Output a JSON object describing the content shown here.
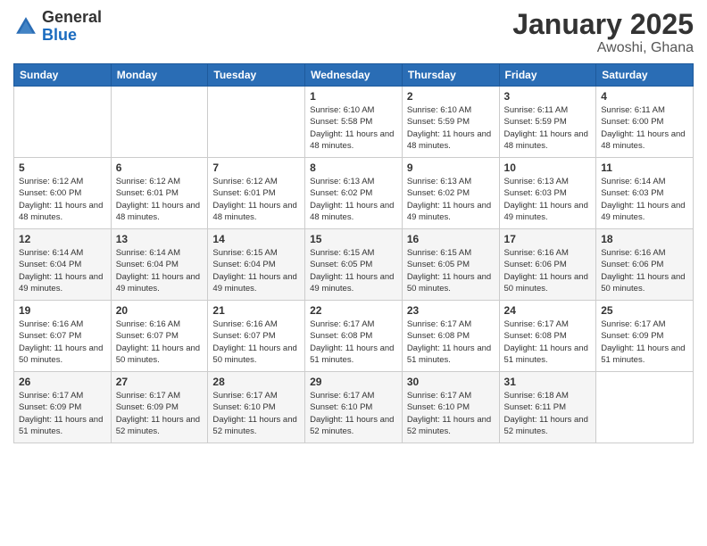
{
  "logo": {
    "general": "General",
    "blue": "Blue"
  },
  "header": {
    "title": "January 2025",
    "subtitle": "Awoshi, Ghana"
  },
  "weekdays": [
    "Sunday",
    "Monday",
    "Tuesday",
    "Wednesday",
    "Thursday",
    "Friday",
    "Saturday"
  ],
  "weeks": [
    [
      {
        "day": "",
        "sunrise": "",
        "sunset": "",
        "daylight": ""
      },
      {
        "day": "",
        "sunrise": "",
        "sunset": "",
        "daylight": ""
      },
      {
        "day": "",
        "sunrise": "",
        "sunset": "",
        "daylight": ""
      },
      {
        "day": "1",
        "sunrise": "Sunrise: 6:10 AM",
        "sunset": "Sunset: 5:58 PM",
        "daylight": "Daylight: 11 hours and 48 minutes."
      },
      {
        "day": "2",
        "sunrise": "Sunrise: 6:10 AM",
        "sunset": "Sunset: 5:59 PM",
        "daylight": "Daylight: 11 hours and 48 minutes."
      },
      {
        "day": "3",
        "sunrise": "Sunrise: 6:11 AM",
        "sunset": "Sunset: 5:59 PM",
        "daylight": "Daylight: 11 hours and 48 minutes."
      },
      {
        "day": "4",
        "sunrise": "Sunrise: 6:11 AM",
        "sunset": "Sunset: 6:00 PM",
        "daylight": "Daylight: 11 hours and 48 minutes."
      }
    ],
    [
      {
        "day": "5",
        "sunrise": "Sunrise: 6:12 AM",
        "sunset": "Sunset: 6:00 PM",
        "daylight": "Daylight: 11 hours and 48 minutes."
      },
      {
        "day": "6",
        "sunrise": "Sunrise: 6:12 AM",
        "sunset": "Sunset: 6:01 PM",
        "daylight": "Daylight: 11 hours and 48 minutes."
      },
      {
        "day": "7",
        "sunrise": "Sunrise: 6:12 AM",
        "sunset": "Sunset: 6:01 PM",
        "daylight": "Daylight: 11 hours and 48 minutes."
      },
      {
        "day": "8",
        "sunrise": "Sunrise: 6:13 AM",
        "sunset": "Sunset: 6:02 PM",
        "daylight": "Daylight: 11 hours and 48 minutes."
      },
      {
        "day": "9",
        "sunrise": "Sunrise: 6:13 AM",
        "sunset": "Sunset: 6:02 PM",
        "daylight": "Daylight: 11 hours and 49 minutes."
      },
      {
        "day": "10",
        "sunrise": "Sunrise: 6:13 AM",
        "sunset": "Sunset: 6:03 PM",
        "daylight": "Daylight: 11 hours and 49 minutes."
      },
      {
        "day": "11",
        "sunrise": "Sunrise: 6:14 AM",
        "sunset": "Sunset: 6:03 PM",
        "daylight": "Daylight: 11 hours and 49 minutes."
      }
    ],
    [
      {
        "day": "12",
        "sunrise": "Sunrise: 6:14 AM",
        "sunset": "Sunset: 6:04 PM",
        "daylight": "Daylight: 11 hours and 49 minutes."
      },
      {
        "day": "13",
        "sunrise": "Sunrise: 6:14 AM",
        "sunset": "Sunset: 6:04 PM",
        "daylight": "Daylight: 11 hours and 49 minutes."
      },
      {
        "day": "14",
        "sunrise": "Sunrise: 6:15 AM",
        "sunset": "Sunset: 6:04 PM",
        "daylight": "Daylight: 11 hours and 49 minutes."
      },
      {
        "day": "15",
        "sunrise": "Sunrise: 6:15 AM",
        "sunset": "Sunset: 6:05 PM",
        "daylight": "Daylight: 11 hours and 49 minutes."
      },
      {
        "day": "16",
        "sunrise": "Sunrise: 6:15 AM",
        "sunset": "Sunset: 6:05 PM",
        "daylight": "Daylight: 11 hours and 50 minutes."
      },
      {
        "day": "17",
        "sunrise": "Sunrise: 6:16 AM",
        "sunset": "Sunset: 6:06 PM",
        "daylight": "Daylight: 11 hours and 50 minutes."
      },
      {
        "day": "18",
        "sunrise": "Sunrise: 6:16 AM",
        "sunset": "Sunset: 6:06 PM",
        "daylight": "Daylight: 11 hours and 50 minutes."
      }
    ],
    [
      {
        "day": "19",
        "sunrise": "Sunrise: 6:16 AM",
        "sunset": "Sunset: 6:07 PM",
        "daylight": "Daylight: 11 hours and 50 minutes."
      },
      {
        "day": "20",
        "sunrise": "Sunrise: 6:16 AM",
        "sunset": "Sunset: 6:07 PM",
        "daylight": "Daylight: 11 hours and 50 minutes."
      },
      {
        "day": "21",
        "sunrise": "Sunrise: 6:16 AM",
        "sunset": "Sunset: 6:07 PM",
        "daylight": "Daylight: 11 hours and 50 minutes."
      },
      {
        "day": "22",
        "sunrise": "Sunrise: 6:17 AM",
        "sunset": "Sunset: 6:08 PM",
        "daylight": "Daylight: 11 hours and 51 minutes."
      },
      {
        "day": "23",
        "sunrise": "Sunrise: 6:17 AM",
        "sunset": "Sunset: 6:08 PM",
        "daylight": "Daylight: 11 hours and 51 minutes."
      },
      {
        "day": "24",
        "sunrise": "Sunrise: 6:17 AM",
        "sunset": "Sunset: 6:08 PM",
        "daylight": "Daylight: 11 hours and 51 minutes."
      },
      {
        "day": "25",
        "sunrise": "Sunrise: 6:17 AM",
        "sunset": "Sunset: 6:09 PM",
        "daylight": "Daylight: 11 hours and 51 minutes."
      }
    ],
    [
      {
        "day": "26",
        "sunrise": "Sunrise: 6:17 AM",
        "sunset": "Sunset: 6:09 PM",
        "daylight": "Daylight: 11 hours and 51 minutes."
      },
      {
        "day": "27",
        "sunrise": "Sunrise: 6:17 AM",
        "sunset": "Sunset: 6:09 PM",
        "daylight": "Daylight: 11 hours and 52 minutes."
      },
      {
        "day": "28",
        "sunrise": "Sunrise: 6:17 AM",
        "sunset": "Sunset: 6:10 PM",
        "daylight": "Daylight: 11 hours and 52 minutes."
      },
      {
        "day": "29",
        "sunrise": "Sunrise: 6:17 AM",
        "sunset": "Sunset: 6:10 PM",
        "daylight": "Daylight: 11 hours and 52 minutes."
      },
      {
        "day": "30",
        "sunrise": "Sunrise: 6:17 AM",
        "sunset": "Sunset: 6:10 PM",
        "daylight": "Daylight: 11 hours and 52 minutes."
      },
      {
        "day": "31",
        "sunrise": "Sunrise: 6:18 AM",
        "sunset": "Sunset: 6:11 PM",
        "daylight": "Daylight: 11 hours and 52 minutes."
      },
      {
        "day": "",
        "sunrise": "",
        "sunset": "",
        "daylight": ""
      }
    ]
  ]
}
